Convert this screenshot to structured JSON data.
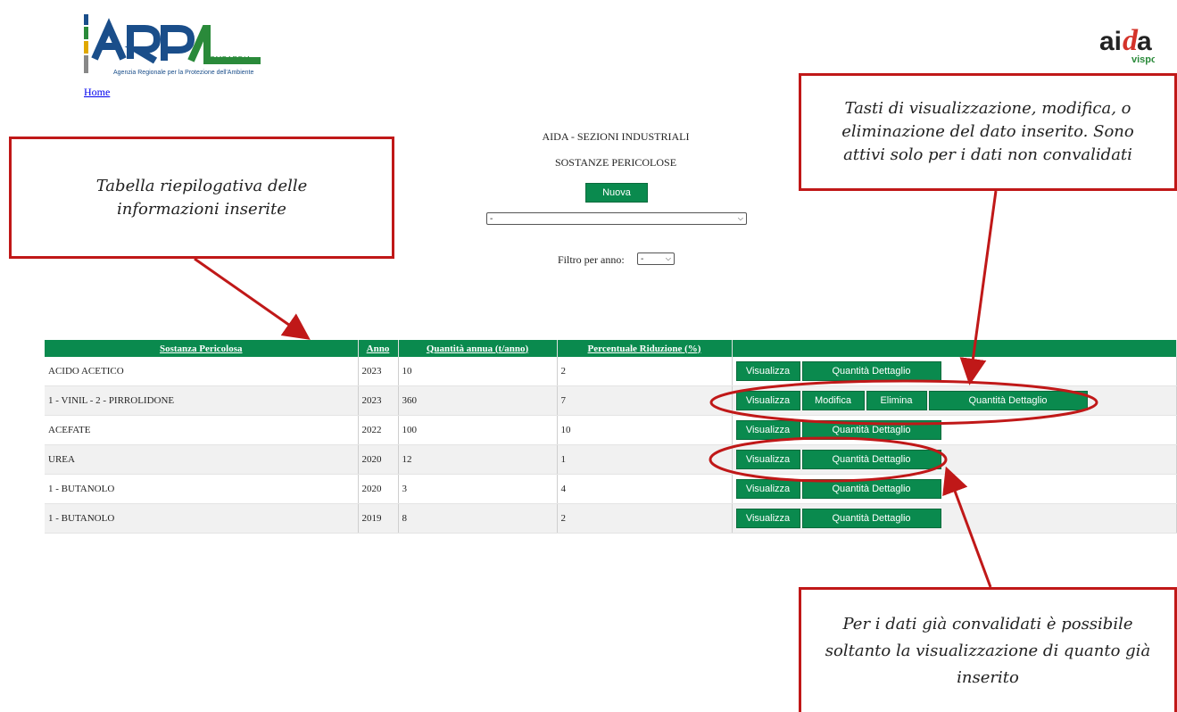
{
  "header": {
    "arpa_logo_text": "ARPA",
    "arpa_region": "LOMBARDIA",
    "arpa_subtitle": "Agenzia Regionale per la Protezione dell'Ambiente",
    "home_link": "Home",
    "aida_logo_text": "aida",
    "aida_sub": "vispo"
  },
  "page": {
    "title": "AIDA - SEZIONI INDUSTRIALI",
    "subtitle": "SOSTANZE PERICOLOSE",
    "new_button": "Nuova",
    "main_select_value": "-",
    "year_filter_label": "Filtro per anno:",
    "year_filter_value": "-"
  },
  "table": {
    "headers": [
      "Sostanza Pericolosa",
      "Anno",
      "Quantità annua (t/anno)",
      "Percentuale Riduzione (%)",
      ""
    ],
    "rows": [
      {
        "sostanza": "ACIDO ACETICO",
        "anno": "2023",
        "quantita": "10",
        "percentuale": "2",
        "editable": false
      },
      {
        "sostanza": "1 - VINIL - 2 - PIRROLIDONE",
        "anno": "2023",
        "quantita": "360",
        "percentuale": "7",
        "editable": true
      },
      {
        "sostanza": "ACEFATE",
        "anno": "2022",
        "quantita": "100",
        "percentuale": "10",
        "editable": false
      },
      {
        "sostanza": "UREA",
        "anno": "2020",
        "quantita": "12",
        "percentuale": "1",
        "editable": false
      },
      {
        "sostanza": "1 - BUTANOLO",
        "anno": "2020",
        "quantita": "3",
        "percentuale": "4",
        "editable": false
      },
      {
        "sostanza": "1 - BUTANOLO",
        "anno": "2019",
        "quantita": "8",
        "percentuale": "2",
        "editable": false
      }
    ],
    "actions": {
      "view": "Visualizza",
      "edit": "Modifica",
      "delete": "Elimina",
      "detail": "Quantità Dettaglio"
    }
  },
  "annotations": {
    "table_note": "Tabella riepilogativa delle informazioni inserite",
    "buttons_note": "Tasti di visualizzazione, modifica, o eliminazione del dato inserito. Sono attivi solo per i dati non convalidati",
    "validated_note": "Per i dati già convalidati è possibile soltanto la visualizzazione di quanto già inserito"
  },
  "colors": {
    "green": "#0a8a4e",
    "annotation_red": "#c01818"
  }
}
